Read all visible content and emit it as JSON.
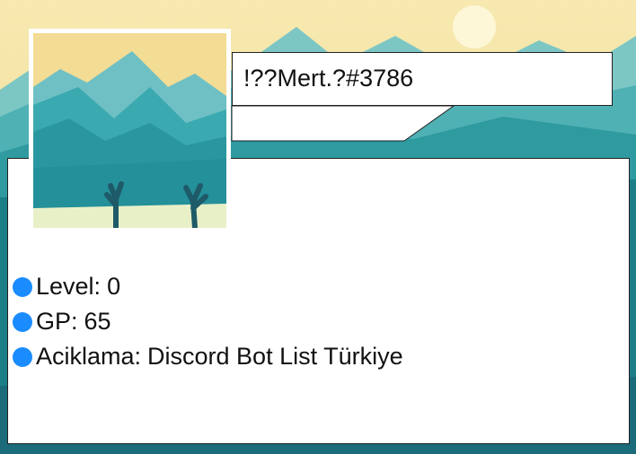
{
  "profile": {
    "username": "!??Mert.?#3786",
    "avatar_icon": "mountain-deer-icon",
    "background": "mountain-landscape-wallpaper"
  },
  "stats": [
    {
      "label": "Level:",
      "value": "0"
    },
    {
      "label": "GP:",
      "value": "65"
    },
    {
      "label": "Aciklama:",
      "value": "Discord Bot List Türkiye"
    }
  ],
  "colors": {
    "bullet": "#1a8cff",
    "sky_top": "#f5e6a8",
    "sky_bottom": "#f0d98a",
    "mountain_teal": "#3ba9b0",
    "mountain_dark": "#1f7f87",
    "card_bg": "#ffffff"
  }
}
